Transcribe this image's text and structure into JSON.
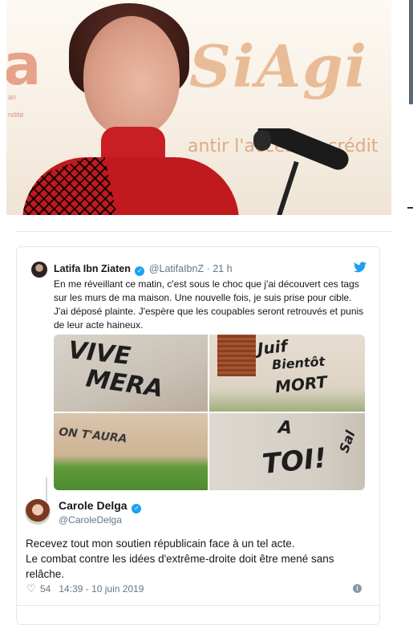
{
  "hero": {
    "logo_text": "SiAgi",
    "logo_left": "a",
    "tagline": "antir l'accès au crédit",
    "left_note_1": "an",
    "left_note_2": "ndité"
  },
  "quoted_tweet": {
    "name": "Latifa Ibn Ziaten",
    "handle": "@LatifaIbnZ",
    "time": "· 21 h",
    "text": "En me réveillant ce matin, c'est sous le choc que j'ai découvert ces tags sur les murs de ma maison. Une nouvelle fois, je suis prise pour cible. J'ai déposé plainte. J'espère que les coupables seront retrouvés et punis de leur acte haineux.",
    "photos": {
      "p1_line1": "VIVE",
      "p1_line2": "MERA",
      "p2_line1": "Juif",
      "p2_line2": "Bientôt",
      "p2_line3": "MORT",
      "p3_line1": "ON T'AURA",
      "p4_line1": "A",
      "p4_line2": "TOI!",
      "p4_line3": "Sal"
    }
  },
  "main_tweet": {
    "name": "Carole Delga",
    "handle": "@CaroleDelga",
    "text_line1": "Recevez tout mon soutien républicain face à un tel acte.",
    "text_line2": "Le combat contre les idées d'extrême-droite doit être mené sans relâche.",
    "likes": "54",
    "timestamp": "14:39 - 10 juin 2019",
    "verified_glyph": "✓",
    "info_glyph": "i"
  },
  "colors": {
    "twitter_blue": "#1da1f2",
    "meta_gray": "#657786",
    "border": "#e1e8ed"
  }
}
